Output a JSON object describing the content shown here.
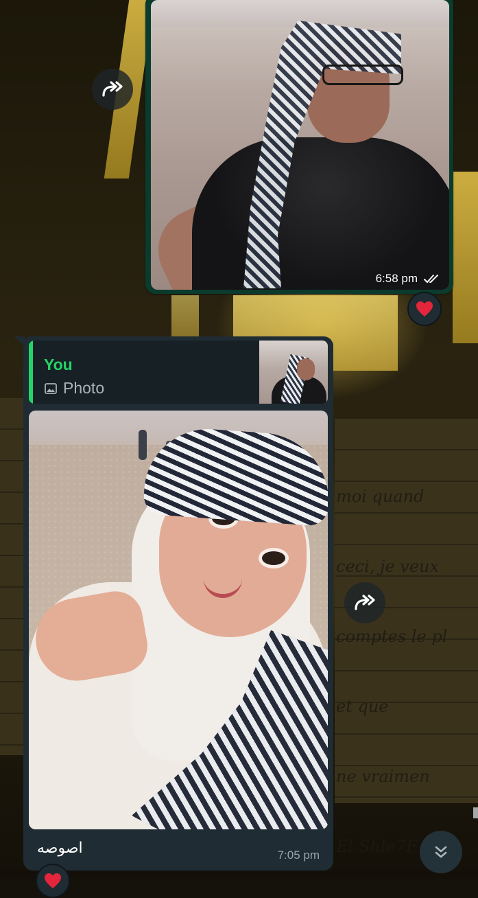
{
  "messages": [
    {
      "direction": "outgoing",
      "type": "photo",
      "time": "6:58 pm",
      "status": "read",
      "reaction": "❤️"
    },
    {
      "direction": "incoming",
      "type": "photo",
      "reply_to": {
        "author": "You",
        "type_label": "Photo"
      },
      "caption": "اصوصه",
      "time": "7:05 pm",
      "reaction": "❤️"
    }
  ],
  "background_note_lines": [
    "moi quand",
    "ceci, je veux",
    "comptes le pl",
    "et que",
    "ne vraimen",
    "El Shle7F"
  ],
  "icons": {
    "forward": "forward-icon",
    "read_receipt": "double-check-icon",
    "reply_photo": "image-icon",
    "scroll_down": "double-chevron-down-icon",
    "reaction": "red-heart-icon"
  },
  "colors": {
    "outgoing_bubble": "#0b3b2d",
    "incoming_bubble": "#1f2c33",
    "accent_green": "#25d366",
    "heart_red": "#e3263b"
  }
}
